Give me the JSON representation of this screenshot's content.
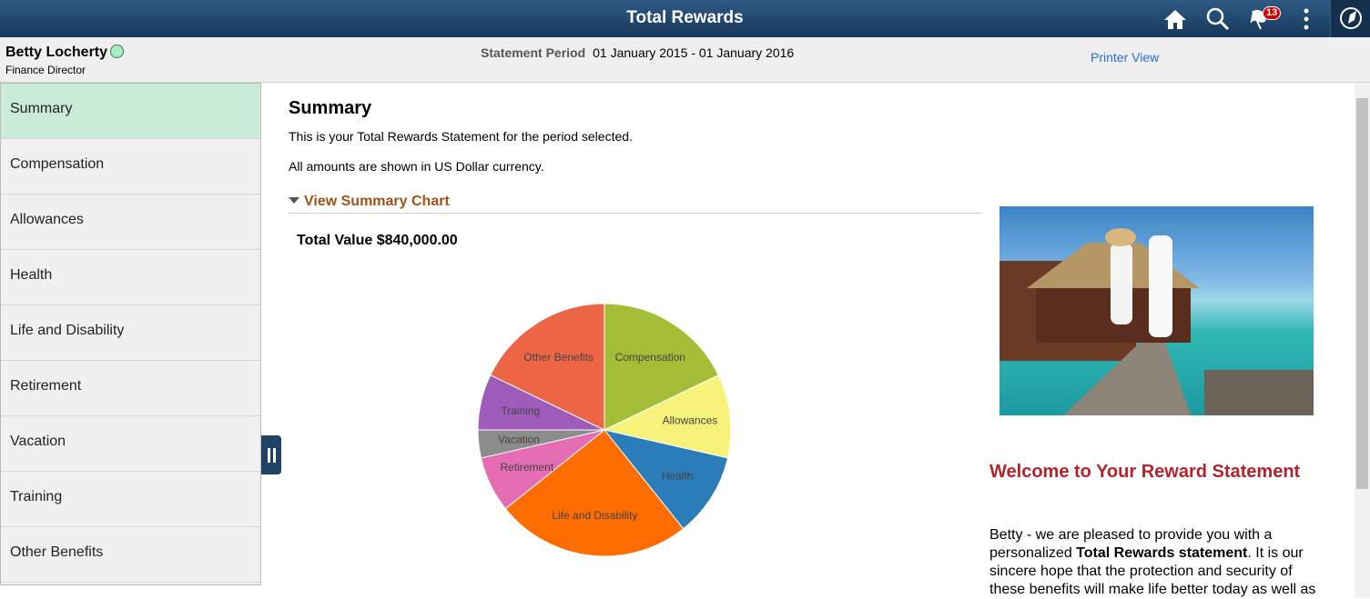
{
  "header": {
    "title": "Total Rewards",
    "icons": [
      "home-icon",
      "search-icon",
      "flag-icon",
      "more-icon",
      "navbar-compass-icon"
    ],
    "notification_count": "13"
  },
  "user": {
    "name": "Betty Locherty",
    "role": "Finance Director"
  },
  "statement": {
    "label": "Statement Period",
    "value": "01 January 2015 - 01 January 2016"
  },
  "printer_view": "Printer View",
  "sidebar": {
    "items": [
      {
        "label": "Summary",
        "active": true
      },
      {
        "label": "Compensation"
      },
      {
        "label": "Allowances"
      },
      {
        "label": "Health"
      },
      {
        "label": "Life and Disability"
      },
      {
        "label": "Retirement"
      },
      {
        "label": "Vacation"
      },
      {
        "label": "Training"
      },
      {
        "label": "Other Benefits"
      }
    ]
  },
  "main": {
    "title": "Summary",
    "line1": "This is your Total Rewards Statement for the period selected.",
    "line2": "All amounts are shown in US Dollar currency.",
    "chart_toggle": "View Summary Chart",
    "total_value": "Total Value $840,000.00",
    "welcome": "Welcome to Your Reward Statement",
    "body_pre": "Betty - we are pleased to provide you with a personalized ",
    "body_bold": "Total Rewards statement",
    "body_post": ". It is our sincere hope that the protection and security of these benefits will make life better today as well as"
  },
  "chart_data": {
    "type": "pie",
    "title": "Total Value $840,000.00",
    "slices": [
      {
        "label": "Compensation",
        "value": 150000,
        "color": "#a3bd37"
      },
      {
        "label": "Allowances",
        "value": 90000,
        "color": "#f7f27a"
      },
      {
        "label": "Health",
        "value": 90000,
        "color": "#2a7db8"
      },
      {
        "label": "Life and Disability",
        "value": 210000,
        "color": "#ff6d00"
      },
      {
        "label": "Retirement",
        "value": 60000,
        "color": "#e46db3"
      },
      {
        "label": "Vacation",
        "value": 30000,
        "color": "#8c8c8c"
      },
      {
        "label": "Training",
        "value": 60000,
        "color": "#9f5bb9"
      },
      {
        "label": "Other Benefits",
        "value": 150000,
        "color": "#ec6646"
      }
    ]
  }
}
